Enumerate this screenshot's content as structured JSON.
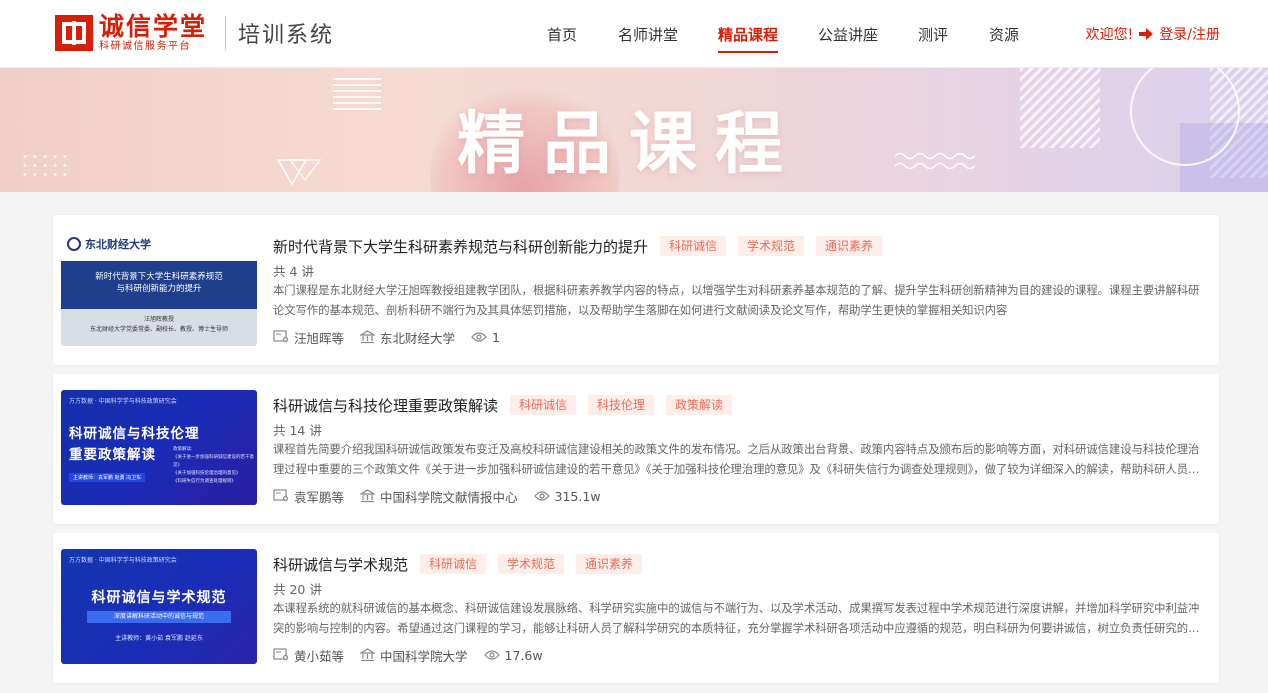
{
  "header": {
    "logo_title": "诚信学堂",
    "logo_subtitle": "科研诚信服务平台",
    "system_name": "培训系统",
    "nav": [
      {
        "label": "首页",
        "active": false
      },
      {
        "label": "名师讲堂",
        "active": false
      },
      {
        "label": "精品课程",
        "active": true
      },
      {
        "label": "公益讲座",
        "active": false
      },
      {
        "label": "测评",
        "active": false
      },
      {
        "label": "资源",
        "active": false
      }
    ],
    "welcome": "欢迎您!",
    "login_label": "登录/注册",
    "login_icon": "login-arrow-icon"
  },
  "banner": {
    "title": "精品课程"
  },
  "courses": [
    {
      "title": "新时代背景下大学生科研素养规范与科研创新能力的提升",
      "tags": [
        "科研诚信",
        "学术规范",
        "通识素养"
      ],
      "lessons": "共 4 讲",
      "description": "本门课程是东北财经大学汪旭晖教授组建教学团队，根据科研素养教学内容的特点，以增强学生对科研素养基本规范的了解、提升学生科研创新精神为目的建设的课程。课程主要讲解科研论文写作的基本规范、剖析科研不端行为及其具体惩罚措施，以及帮助学生落脚在如何进行文献阅读及论文写作，帮助学生更快的掌握相关知识内容",
      "teacher": "汪旭晖等",
      "institution": "东北财经大学",
      "views": "1",
      "cover": {
        "university": "东北财经大学",
        "headline_1": "新时代背景下大学生科研素养规范",
        "headline_2": "与科研创新能力的提升",
        "presenter": "汪旭晖教授",
        "presenter_title": "东北财经大学党委常委、副校长、教授、博士生导师"
      }
    },
    {
      "title": "科研诚信与科技伦理重要政策解读",
      "tags": [
        "科研诚信",
        "科技伦理",
        "政策解读"
      ],
      "lessons": "共 14 讲",
      "description": "课程首先简要介绍我国科研诚信政策发布变迁及高校科研诚信建设相关的政策文件的发布情况。之后从政策出台背景、政策内容特点及颁布后的影响等方面，对科研诚信建设与科技伦理治理过程中重要的三个政策文件《关于进一步加强科研诚信建设的若干意见》《关于加强科技伦理治理的意见》及《科研失信行为调查处理规则》，做了较为详细深入的解读，帮助科研人员、科研管理人员...",
      "teacher": "袁军鹏等",
      "institution": "中国科学院文献情报中心",
      "views": "315.1w",
      "cover": {
        "logos": "万方数据 · 中国科学学与科技政策研究会",
        "headline_1": "科研诚信与科技伦理",
        "headline_2": "重要政策解读",
        "side_label": "政策解读:",
        "side_items": [
          "《关于进一步加强科研诚信建设的若干意见》",
          "《关于加强科技伦理治理的意见》",
          "《科研失信行为调查处理规则》"
        ],
        "names": "主讲教师：袁军鹏  赵勇  冯卫东"
      }
    },
    {
      "title": "科研诚信与学术规范",
      "tags": [
        "科研诚信",
        "学术规范",
        "通识素养"
      ],
      "lessons": "共 20 讲",
      "description": "本课程系统的就科研诚信的基本概念、科研诚信建设发展脉络、科学研究实施中的诚信与不端行为、以及学术活动、成果撰写发表过程中学术规范进行深度讲解，并增加科学研究中利益冲突的影响与控制的内容。希望通过这门课程的学习，能够让科研人员了解科学研究的本质特征，充分掌握学术科研各项活动中应遵循的规范，明白科研为何要讲诚信，树立负责任研究的意识，清楚研究者...",
      "teacher": "黄小茹等",
      "institution": "中国科学院大学",
      "views": "17.6w",
      "cover": {
        "logos": "万方数据 · 中国科学学与科技政策研究会",
        "headline": "科研诚信与学术规范",
        "strip": "深度讲解科研活动中的诚信与规范",
        "names": "主讲教师：黄小茹  袁军鹏  赵延东"
      }
    }
  ],
  "icons": {
    "teacher": "teacher-board-icon",
    "institution": "institution-building-icon",
    "views": "eye-icon"
  },
  "colors": {
    "brand_red": "#d81e06",
    "tag_text": "#f06b57",
    "tag_bg": "#fdeeea",
    "page_bg": "#f4f4f5"
  }
}
